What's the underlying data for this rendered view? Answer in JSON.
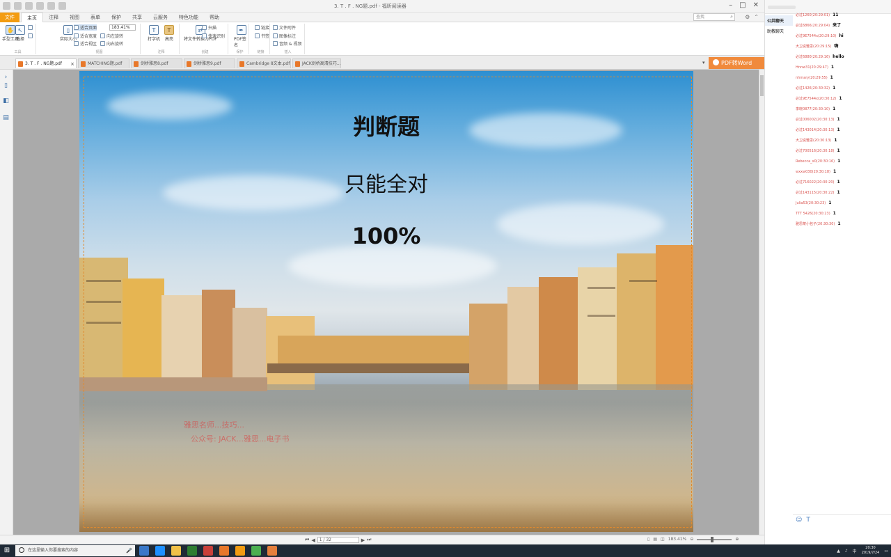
{
  "window": {
    "title": "3. T . F . NG题.pdf - 福昕阅读器"
  },
  "menu": {
    "file": "文件",
    "tabs": [
      "主页",
      "注释",
      "视图",
      "表单",
      "保护",
      "共享",
      "云服务",
      "特色功能",
      "帮助"
    ],
    "active_tab": "主页",
    "search_placeholder": "查找"
  },
  "ribbon": {
    "hand": "手型工具",
    "select": "选择",
    "screenshot": "截图",
    "clipboard": "剪贴板",
    "actual_size": "实际大小",
    "fit_page": "适合页面",
    "fit_width": "适合宽度",
    "fit_visible": "适合视区",
    "rotate_left": "向左旋转",
    "rotate_right": "向右旋转",
    "zoom_value": "183.41%",
    "typewriter": "打字机",
    "highlight": "高亮",
    "pdf_convert": "将文件转换为PDF",
    "scan": "扫描",
    "quick": "快速识别",
    "pdf_sign": "PDF签名",
    "link": "链接",
    "bookmark": "书签",
    "file_attach": "文件附件",
    "image_annot": "图像标注",
    "audio_video": "音频 & 视频",
    "group_labels": [
      "工具",
      "视图",
      "注释",
      "创建",
      "保护",
      "链接",
      "插入"
    ]
  },
  "tabs": [
    {
      "label": "3. T . F . NG题.pdf",
      "active": true
    },
    {
      "label": "MATCHING题.pdf",
      "active": false
    },
    {
      "label": "剑桥雅思8.pdf",
      "active": false
    },
    {
      "label": "剑桥雅思9.pdf",
      "active": false
    },
    {
      "label": "Cambridge 8文本.pdf",
      "active": false
    },
    {
      "label": "JACK剑桥高清技巧...",
      "active": false
    }
  ],
  "promo": {
    "label": "PDF转Word"
  },
  "page": {
    "title": "判断题",
    "line2": "只能全对",
    "line3": "100%",
    "watermark1": "雅思名师...技巧...",
    "watermark2": "公众号: JACK...雅思...电子书"
  },
  "status": {
    "page_indicator": "1 / 32",
    "zoom_label": "183.41%"
  },
  "chat": {
    "nav": [
      "公共聊天",
      "助教聊天"
    ],
    "messages": [
      {
        "name": "必过1260(20:29:01)",
        "text": "11"
      },
      {
        "name": "必过6866(20:29:04)",
        "text": "来了"
      },
      {
        "name": "必过9E7544x(20:29:10)",
        "text": "hi"
      },
      {
        "name": "大卫说雅思(20:29:15)",
        "text": "嗨"
      },
      {
        "name": "必过6880(20:29:16)",
        "text": "hello"
      },
      {
        "name": "Hnnw31(20:29:47)",
        "text": "1"
      },
      {
        "name": "nhmary(20:29:55)",
        "text": "1"
      },
      {
        "name": "必过1426(20:30:32)",
        "text": "1"
      },
      {
        "name": "必过9E7544x(20:30:12)",
        "text": "1"
      },
      {
        "name": "李晓0877(20:30:10)",
        "text": "1"
      },
      {
        "name": "必过006002(20:30:13)",
        "text": "1"
      },
      {
        "name": "必过143014(20:30:13)",
        "text": "1"
      },
      {
        "name": "大卫说雅思(20:30:13)",
        "text": "1"
      },
      {
        "name": "必过700516(20:30:18)",
        "text": "1"
      },
      {
        "name": "Rebecca_x0(20:30:16)",
        "text": "1"
      },
      {
        "name": "wxxw030(20:30:18)",
        "text": "1"
      },
      {
        "name": "必过716022(20:30:20)",
        "text": "1"
      },
      {
        "name": "必过143115(20:30:22)",
        "text": "1"
      },
      {
        "name": "Julia53(20:30:23)",
        "text": "1"
      },
      {
        "name": "TTT 5426(20:30:23)",
        "text": "1"
      },
      {
        "name": "雅思菜小包子(20:30:30)",
        "text": "1"
      }
    ],
    "tools": [
      "☺",
      "T"
    ]
  },
  "taskbar": {
    "search_placeholder": "在这里输入你要搜索的内容",
    "time": "20:30",
    "date": "2019/7/24",
    "lang": "中",
    "app_colors": [
      "#3a78c8",
      "#1e90ff",
      "#f0c048",
      "#2f7d32",
      "#c9403a",
      "#e8782a",
      "#f39c12",
      "#4caf50",
      "#e57f3c"
    ]
  }
}
